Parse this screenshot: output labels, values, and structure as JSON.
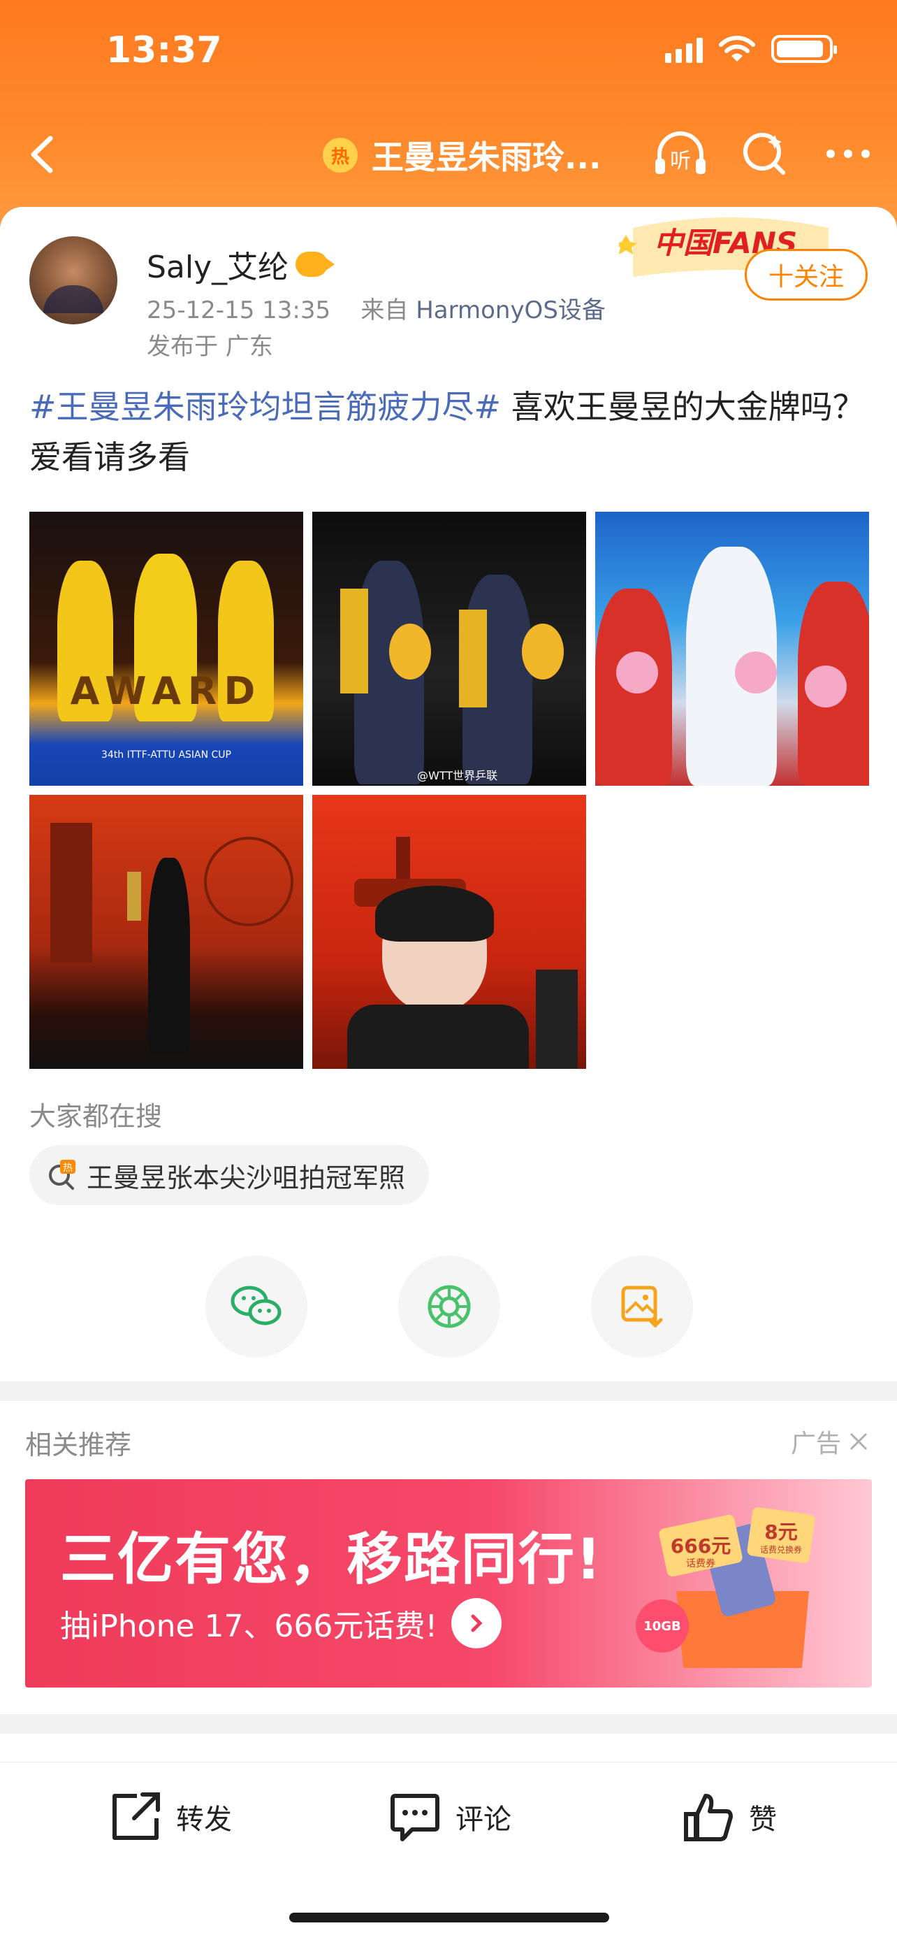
{
  "status_bar": {
    "time": "13:37"
  },
  "nav": {
    "hot_badge": "热",
    "title": "王曼昱朱雨玲...",
    "listen_label": "听"
  },
  "post": {
    "author": "Saly_艾纶",
    "time": "25-12-15 13:35",
    "source_prefix": "来自",
    "source_device": "HarmonyOS设备",
    "location": "发布于 广东",
    "fans_banner_text": "中国FANS",
    "follow_label": "十关注",
    "topic": "#王曼昱朱雨玲均坦言筋疲力尽#",
    "body": " 喜欢王曼昱的大金牌吗？爱看请多看",
    "photos": [
      {
        "caption": "AWARD",
        "sub": "34th ITTF-ATTU ASIAN CUP"
      },
      {
        "caption": "@WTT世界乒联",
        "sub": ""
      },
      {
        "caption": "",
        "sub": ""
      },
      {
        "caption": "",
        "sub": ""
      },
      {
        "caption": "",
        "sub": ""
      }
    ]
  },
  "search": {
    "label": "大家都在搜",
    "chip_text": "王曼昱张本尖沙咀拍冠军照",
    "chip_badge": "热"
  },
  "share": {
    "items": [
      "wechat-icon",
      "moments-icon",
      "save-image-icon"
    ]
  },
  "related": {
    "title": "相关推荐",
    "ad_label": "广告"
  },
  "ad": {
    "headline": "三亿有您，移路同行!",
    "sub": "抽iPhone 17、666元话费!",
    "tag1": "666元",
    "tag1_sub": "话费券",
    "tag2": "8元",
    "tag2_sub": "话费兑换券",
    "tag3": "10GB"
  },
  "bottom_bar": {
    "repost": "转发",
    "comment": "评论",
    "like": "赞"
  },
  "colors": {
    "brand_orange": "#ff8200",
    "topic_blue": "#4a6bb8",
    "ad_red": "#ef3b5a"
  }
}
